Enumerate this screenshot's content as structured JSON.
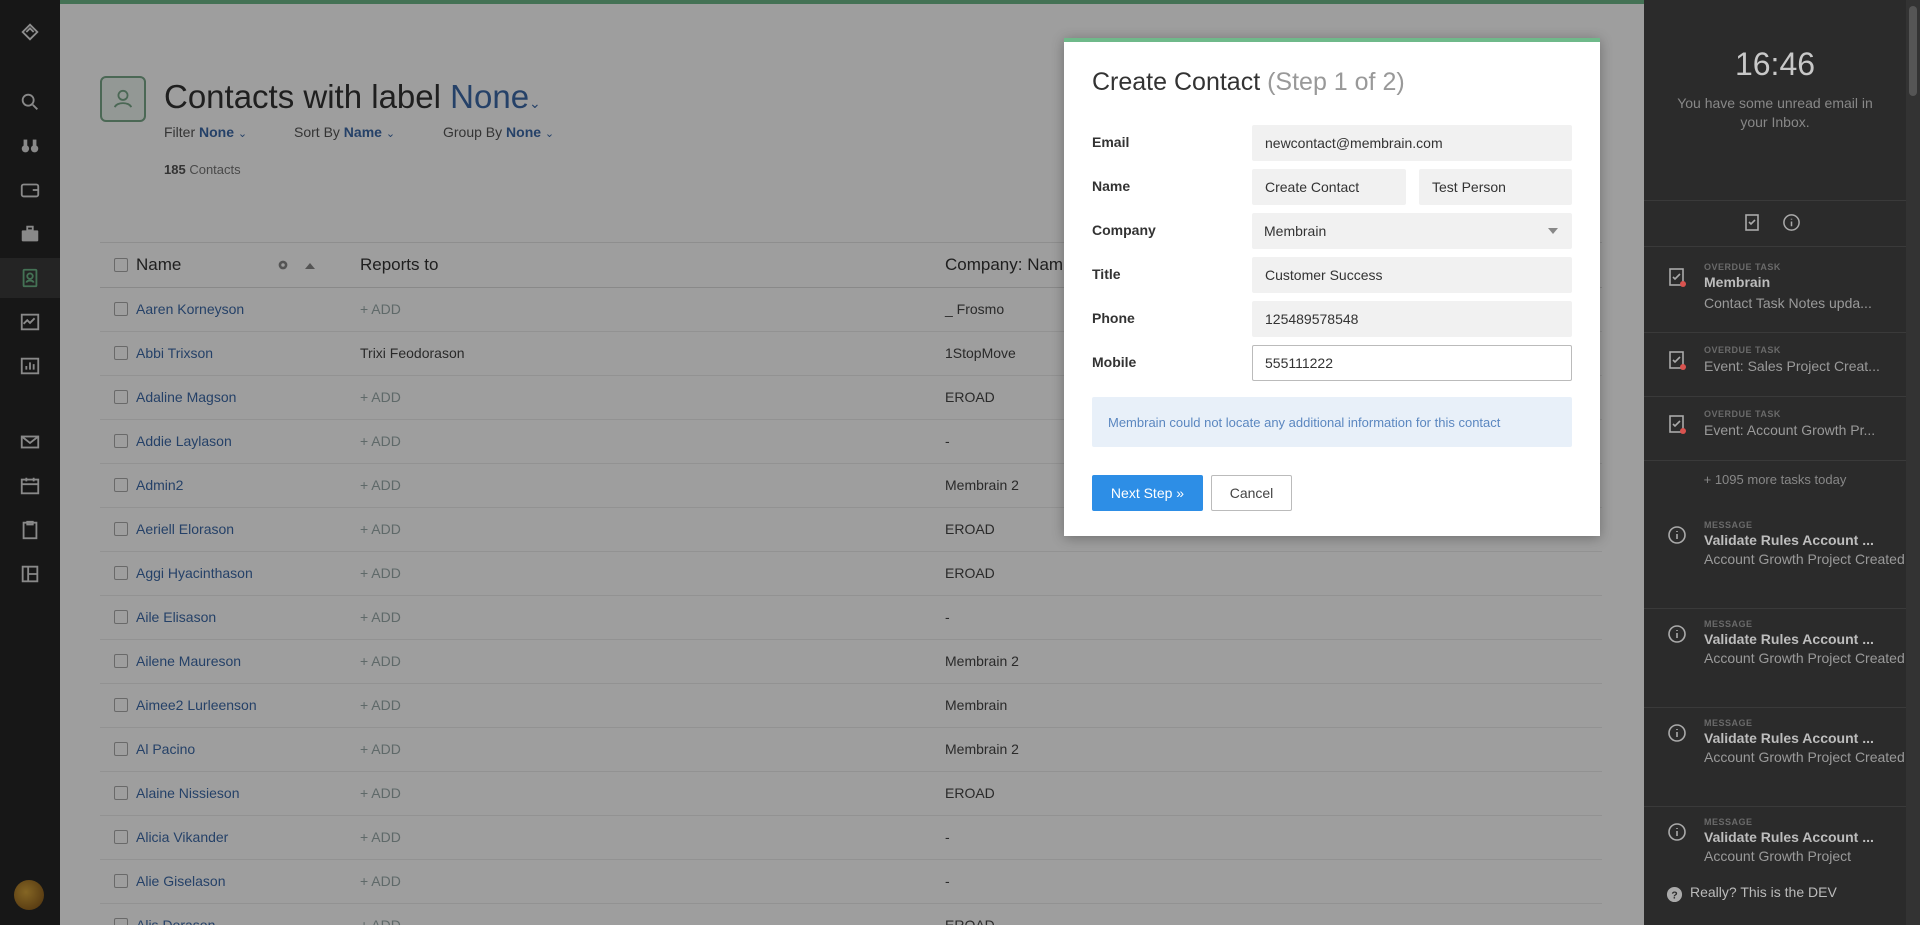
{
  "header": {
    "title_prefix": "Contacts with label",
    "title_label": "None",
    "filter_label": "Filter",
    "filter_value": "None",
    "sort_label": "Sort By",
    "sort_value": "Name",
    "group_label": "Group By",
    "group_value": "None",
    "count_number": "185",
    "count_label": "Contacts"
  },
  "table": {
    "columns": [
      "Name",
      "Reports to",
      "Company: Nam"
    ],
    "rows": [
      {
        "name": "Aaren Korneyson",
        "reports_to": "+ ADD",
        "company": "_ Frosmo"
      },
      {
        "name": "Abbi Trixson",
        "reports_to": "Trixi Feodorason",
        "company": "1StopMove"
      },
      {
        "name": "Adaline Magson",
        "reports_to": "+ ADD",
        "company": "EROAD"
      },
      {
        "name": "Addie Laylason",
        "reports_to": "+ ADD",
        "company": "-"
      },
      {
        "name": "Admin2",
        "reports_to": "+ ADD",
        "company": "Membrain 2"
      },
      {
        "name": "Aeriell Elorason",
        "reports_to": "+ ADD",
        "company": "EROAD"
      },
      {
        "name": "Aggi Hyacinthason",
        "reports_to": "+ ADD",
        "company": "EROAD"
      },
      {
        "name": "Aile Elisason",
        "reports_to": "+ ADD",
        "company": "-"
      },
      {
        "name": "Ailene Maureson",
        "reports_to": "+ ADD",
        "company": "Membrain 2"
      },
      {
        "name": "Aimee2 Lurleenson",
        "reports_to": "+ ADD",
        "company": "Membrain"
      },
      {
        "name": "Al Pacino",
        "reports_to": "+ ADD",
        "company": "Membrain 2"
      },
      {
        "name": "Alaine Nissieson",
        "reports_to": "+ ADD",
        "company": "EROAD"
      },
      {
        "name": "Alicia Vikander",
        "reports_to": "+ ADD",
        "company": "-"
      },
      {
        "name": "Alie Giselason",
        "reports_to": "+ ADD",
        "company": "-"
      },
      {
        "name": "Alis Dorason",
        "reports_to": "+ ADD",
        "company": "EROAD"
      }
    ]
  },
  "modal": {
    "title": "Create Contact",
    "step": "(Step 1 of 2)",
    "email_label": "Email",
    "email_value": "newcontact@membrain.com",
    "name_label": "Name",
    "first_name": "Create Contact",
    "last_name": "Test Person",
    "company_label": "Company",
    "company_value": "Membrain",
    "title_label": "Title",
    "title_value": "Customer Success",
    "phone_label": "Phone",
    "phone_value": "125489578548",
    "mobile_label": "Mobile",
    "mobile_value": "555111222",
    "info_text": "Membrain could not locate any additional information for this contact",
    "next_label": "Next Step »",
    "cancel_label": "Cancel"
  },
  "right_panel": {
    "time": "16:46",
    "unread_text": "You have some unread email in your Inbox.",
    "tasks": [
      {
        "kind": "OVERDUE TASK",
        "title": "Membrain",
        "detail": "Contact Task Notes upda..."
      },
      {
        "kind": "OVERDUE TASK",
        "title": "",
        "detail": "Event: Sales Project Creat..."
      },
      {
        "kind": "OVERDUE TASK",
        "title": "",
        "detail": "Event: Account Growth Pr..."
      }
    ],
    "more_tasks": "+ 1095 more tasks today",
    "messages": [
      {
        "kind": "MESSAGE",
        "title": "Validate Rules Account ...",
        "detail": "Account Growth Project Created"
      },
      {
        "kind": "MESSAGE",
        "title": "Validate Rules Account ...",
        "detail": "Account Growth Project Created"
      },
      {
        "kind": "MESSAGE",
        "title": "Validate Rules Account ...",
        "detail": "Account Growth Project Created"
      },
      {
        "kind": "MESSAGE",
        "title": "Validate Rules Account ...",
        "detail": "Account Growth Project"
      }
    ],
    "dev_text": "Really? This is the DEV"
  },
  "colors": {
    "accent_blue": "#3d6aa8",
    "primary_button": "#2d8ee6",
    "top_bar_green": "#6fb98a",
    "sidebar_bg": "#262626",
    "right_panel_bg": "#2b2b2b"
  },
  "icons": {
    "rail": [
      "logo-icon",
      "search-icon",
      "binoculars-icon",
      "wallet-icon",
      "briefcase-icon",
      "contacts-icon",
      "activity-icon",
      "reports-icon",
      "mail-icon",
      "calendar-icon",
      "tasks-icon",
      "dashboard-icon"
    ]
  }
}
